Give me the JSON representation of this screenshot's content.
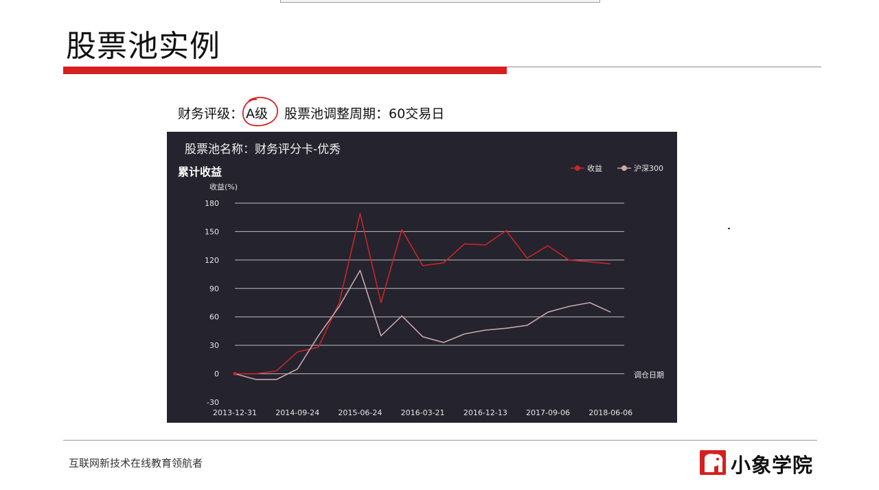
{
  "slide": {
    "title": "股票池实例",
    "rating_label": "财务评级：",
    "rating_value": "A级",
    "period_label": "股票池调整周期：60交易日",
    "footer": "互联网新技术在线教育领航者",
    "logo_text": "小象学院"
  },
  "colors": {
    "accent_red": "#d61f1f",
    "panel_bg": "#25232d",
    "series_return": "#c8252b",
    "series_hs300": "#c9a9ad",
    "grid": "#d9d9d9"
  },
  "chart_data": {
    "type": "line",
    "pool_name": "股票池名称：财务评分卡-优秀",
    "title": "累计收益",
    "ylabel": "收益(%)",
    "xlabel": "调仓日期",
    "ylim": [
      -30,
      180
    ],
    "yticks": [
      -30,
      0,
      30,
      60,
      90,
      120,
      150,
      180
    ],
    "xtick_labels": [
      "2013-12-31",
      "2014-09-24",
      "2015-06-24",
      "2016-03-21",
      "2016-12-13",
      "2017-09-06",
      "2018-06-06"
    ],
    "point_count": 22,
    "legend_position": "top-right",
    "grid": true,
    "series": [
      {
        "name": "收益",
        "values": [
          0,
          0,
          3,
          23,
          28,
          75,
          169,
          75,
          152,
          114,
          117,
          137,
          136,
          151,
          122,
          135,
          120,
          118,
          116,
          null,
          null,
          null
        ]
      },
      {
        "name": "沪深300",
        "values": [
          0,
          -6,
          -6,
          5,
          40,
          71,
          109,
          40,
          61,
          39,
          33,
          42,
          46,
          48,
          51,
          65,
          71,
          75,
          65,
          null,
          null,
          null
        ]
      }
    ]
  }
}
